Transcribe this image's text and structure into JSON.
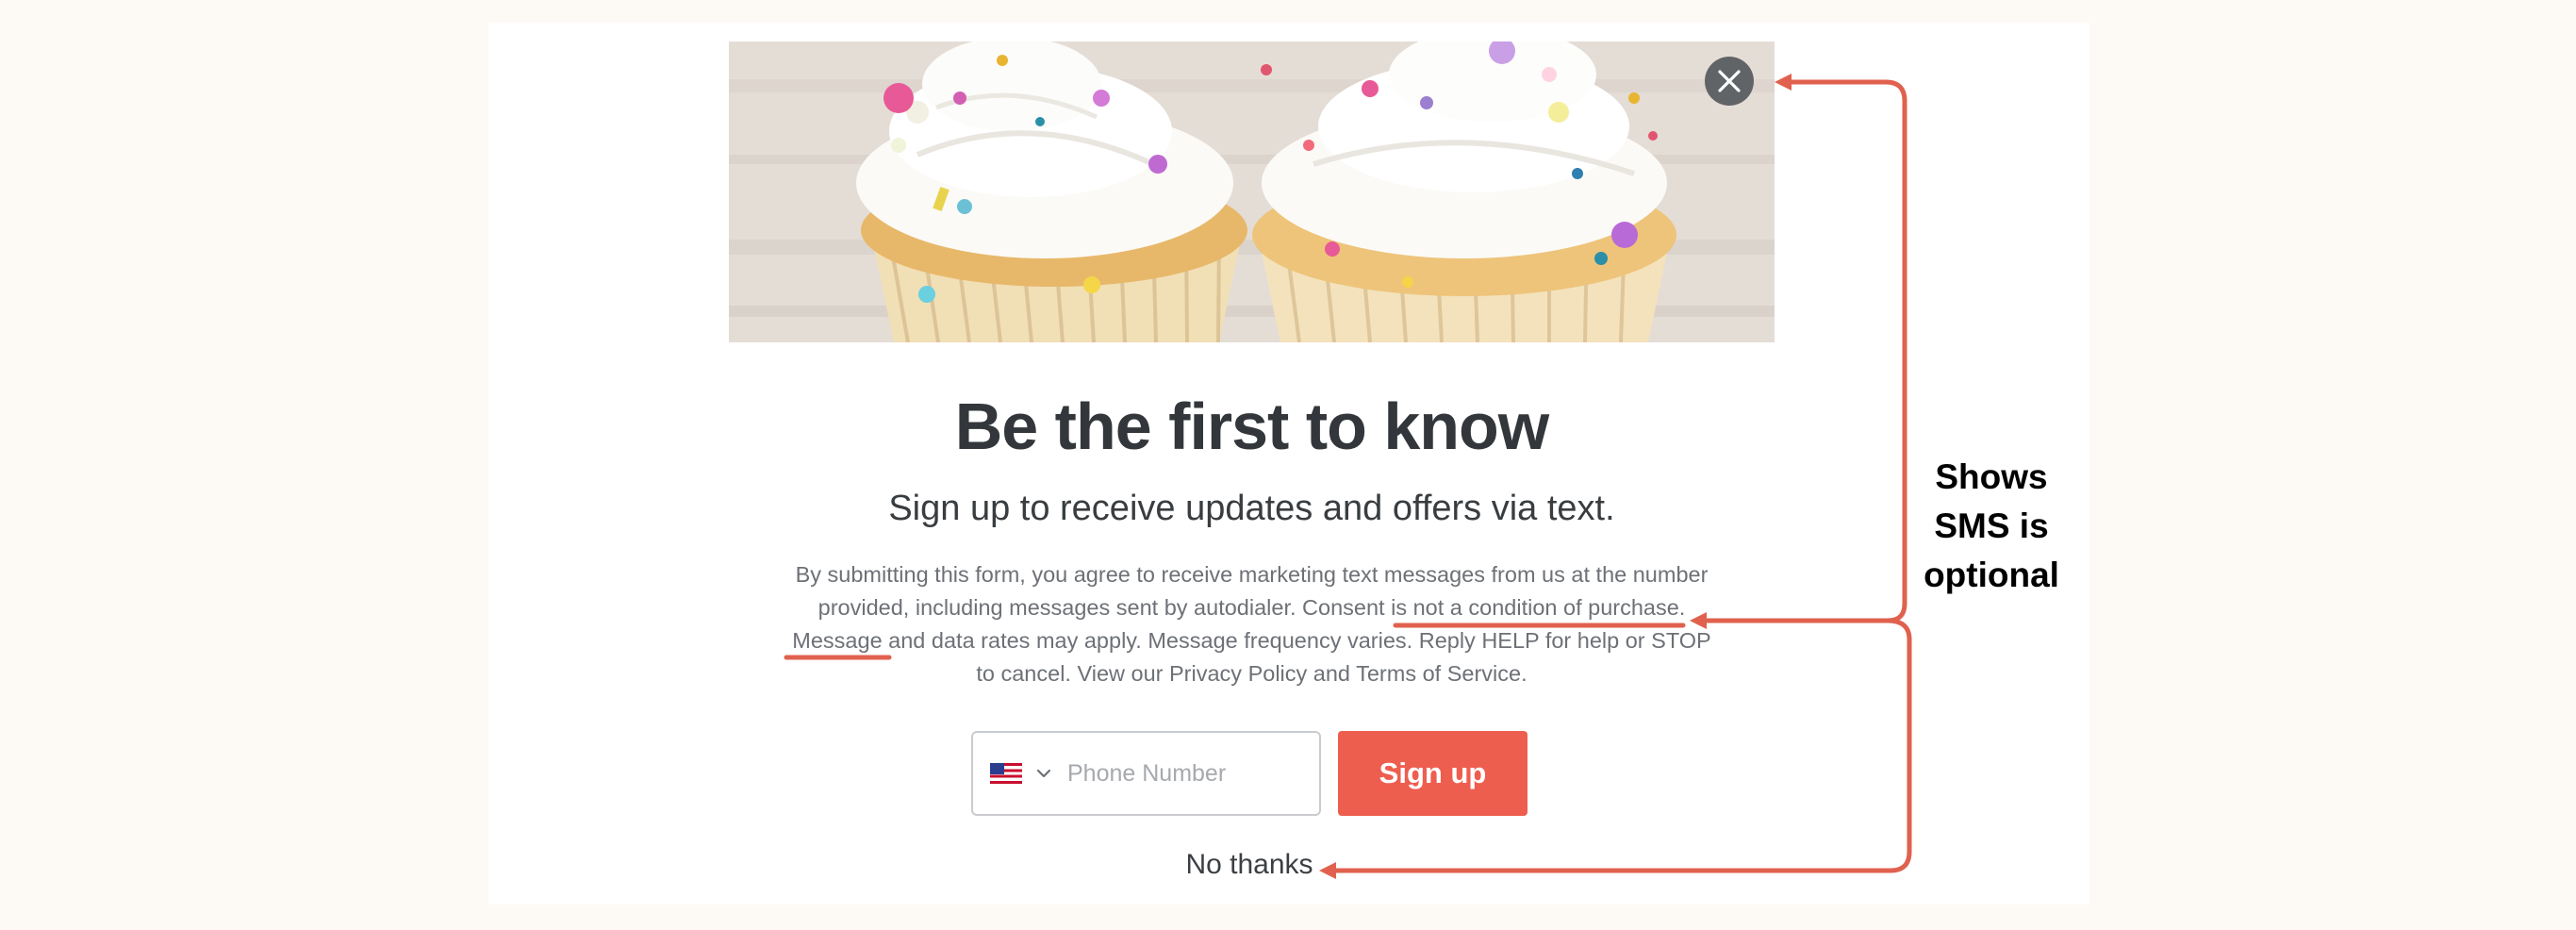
{
  "modal": {
    "headline": "Be the first to know",
    "subheadline": "Sign up to receive updates and offers via text.",
    "legal_text": {
      "part1": "By submitting this form, you agree to receive marketing text messages from us at the number provided, including messages sent by autodialer. ",
      "consent": "Consent is not a condition of purchase.",
      "part2": " Message and data rates may apply. Message frequency varies. Reply HELP for help or STOP to cancel. View our Privacy Policy and Terms of Service."
    },
    "phone": {
      "placeholder": "Phone Number",
      "value": "",
      "country_icon": "us-flag-icon"
    },
    "signup_label": "Sign up",
    "no_thanks_label": "No thanks",
    "close_icon": "close-icon",
    "hero_image": "cupcakes-image"
  },
  "annotation": {
    "line1": "Shows",
    "line2": "SMS is",
    "line3": "optional"
  },
  "colors": {
    "page_background": "#fdf9f5",
    "annotation_arrow": "#e0614e",
    "signup_button": "#ee5e4f",
    "headline": "#33373b",
    "close_button": "#616466"
  }
}
